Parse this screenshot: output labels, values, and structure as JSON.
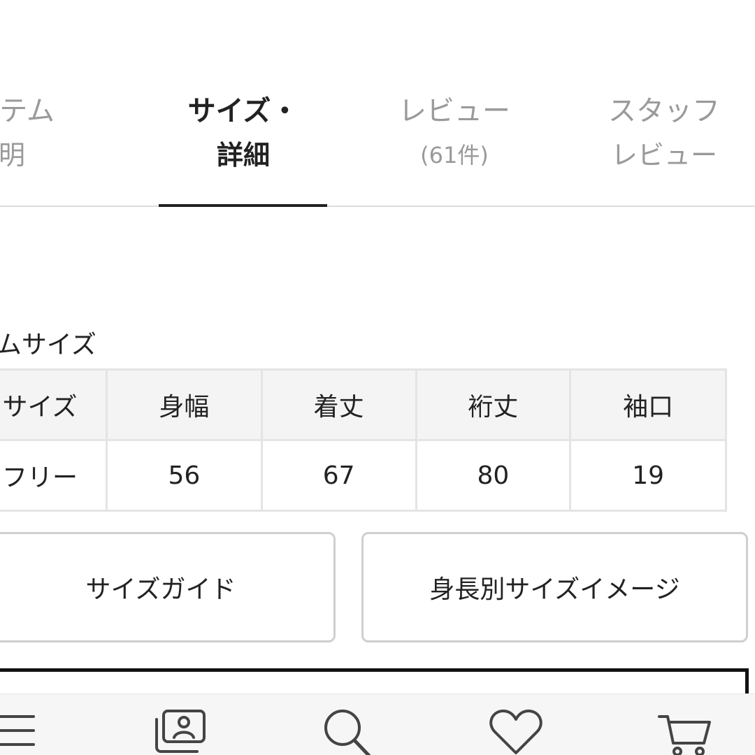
{
  "tabs": [
    {
      "line1": "イテム",
      "line2": "説明",
      "active": false
    },
    {
      "line1": "サイズ・",
      "line2": "詳細",
      "active": true
    },
    {
      "line1": "レビュー",
      "line2": "(61件)",
      "active": false
    },
    {
      "line1": "スタッフ",
      "line2": "レビュー",
      "active": false
    }
  ],
  "size_section": {
    "title": "テムサイズ",
    "table": {
      "headers": [
        "サイズ",
        "身幅",
        "着丈",
        "裄丈",
        "袖口"
      ],
      "rows": [
        [
          "フリー",
          "56",
          "67",
          "80",
          "19"
        ]
      ]
    }
  },
  "buttons": {
    "size_guide": "サイズガイド",
    "height_image": "身長別サイズイメージ"
  },
  "bottom_nav": {
    "icons": [
      "menu-icon",
      "profile-card-icon",
      "search-icon",
      "heart-icon",
      "cart-icon"
    ]
  },
  "colors": {
    "active_text": "#222222",
    "inactive_text": "#9a9a9a",
    "table_header_bg": "#f4f4f4",
    "table_border": "#e4e4e4",
    "button_border": "#cfcfcf",
    "nav_bg": "#f6f6f6",
    "icon_stroke": "#444444"
  }
}
